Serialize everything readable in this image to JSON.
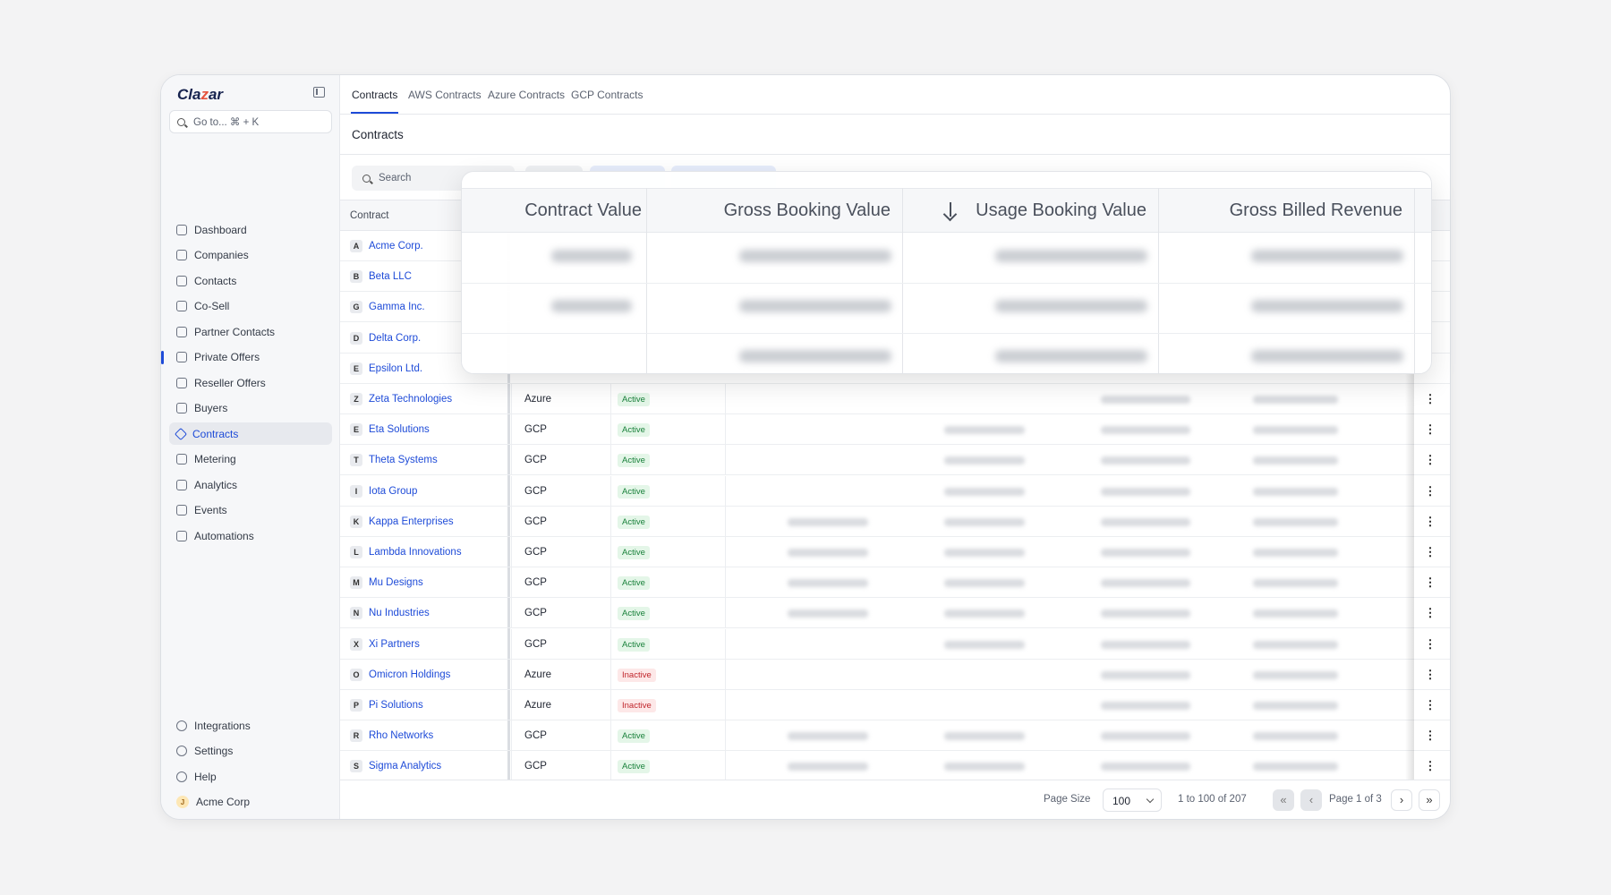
{
  "app": {
    "logo_pre": "Cla",
    "logo_z": "z",
    "logo_post": "ar"
  },
  "sidebar": {
    "search_placeholder": "Go to... ⌘ + K",
    "items": [
      {
        "label": "Dashboard",
        "icon": "dashboard-icon"
      },
      {
        "label": "Companies",
        "icon": "building-icon"
      },
      {
        "label": "Contacts",
        "icon": "contacts-icon"
      },
      {
        "label": "Co-Sell",
        "icon": "cosell-icon"
      },
      {
        "label": "Partner Contacts",
        "icon": "partner-contacts-icon"
      },
      {
        "label": "Private Offers",
        "icon": "tag-icon"
      },
      {
        "label": "Reseller Offers",
        "icon": "reseller-icon"
      },
      {
        "label": "Buyers",
        "icon": "users-icon"
      },
      {
        "label": "Contracts",
        "icon": "contract-icon",
        "active": true
      },
      {
        "label": "Metering",
        "icon": "gauge-icon"
      },
      {
        "label": "Analytics",
        "icon": "chart-icon"
      },
      {
        "label": "Events",
        "icon": "events-icon"
      },
      {
        "label": "Automations",
        "icon": "automation-icon"
      }
    ],
    "bottom": [
      {
        "label": "Integrations",
        "icon": "plug-icon"
      },
      {
        "label": "Settings",
        "icon": "gear-icon"
      },
      {
        "label": "Help",
        "icon": "help-icon"
      }
    ],
    "user": {
      "initial": "J",
      "label": "Acme Corp"
    }
  },
  "tabs": [
    "Contracts",
    "AWS Contracts",
    "Azure Contracts",
    "GCP Contracts"
  ],
  "page_title": "Contracts",
  "table": {
    "search_placeholder": "Search",
    "col_contract": "Contract",
    "rows": [
      {
        "l": "A",
        "name": "Acme Corp."
      },
      {
        "l": "B",
        "name": "Beta LLC"
      },
      {
        "l": "G",
        "name": "Gamma Inc."
      },
      {
        "l": "D",
        "name": "Delta Corp."
      },
      {
        "l": "E",
        "name": "Epsilon Ltd."
      },
      {
        "l": "Z",
        "name": "Zeta Technologies",
        "mkt": "Azure",
        "status": "Active"
      },
      {
        "l": "E",
        "name": "Eta Solutions",
        "mkt": "GCP",
        "status": "Active"
      },
      {
        "l": "T",
        "name": "Theta Systems",
        "mkt": "GCP",
        "status": "Active"
      },
      {
        "l": "I",
        "name": "Iota Group",
        "mkt": "GCP",
        "status": "Active"
      },
      {
        "l": "K",
        "name": "Kappa Enterprises",
        "mkt": "GCP",
        "status": "Active"
      },
      {
        "l": "L",
        "name": "Lambda Innovations",
        "mkt": "GCP",
        "status": "Active"
      },
      {
        "l": "M",
        "name": "Mu Designs",
        "mkt": "GCP",
        "status": "Active"
      },
      {
        "l": "N",
        "name": "Nu Industries",
        "mkt": "GCP",
        "status": "Active"
      },
      {
        "l": "X",
        "name": "Xi Partners",
        "mkt": "GCP",
        "status": "Active"
      },
      {
        "l": "O",
        "name": "Omicron Holdings",
        "mkt": "Azure",
        "status": "Inactive"
      },
      {
        "l": "P",
        "name": "Pi Solutions",
        "mkt": "Azure",
        "status": "Inactive"
      },
      {
        "l": "R",
        "name": "Rho Networks",
        "mkt": "GCP",
        "status": "Active"
      },
      {
        "l": "S",
        "name": "Sigma Analytics",
        "mkt": "GCP",
        "status": "Active"
      }
    ]
  },
  "overlay": {
    "headers": [
      "Contract Value",
      "Gross Booking Value",
      "Usage Booking Value",
      "Gross Billed Revenue"
    ]
  },
  "footer": {
    "page_size_label": "Page Size",
    "page_size": "100",
    "range": "1 to 100 of 207",
    "page": "Page 1 of 3"
  }
}
